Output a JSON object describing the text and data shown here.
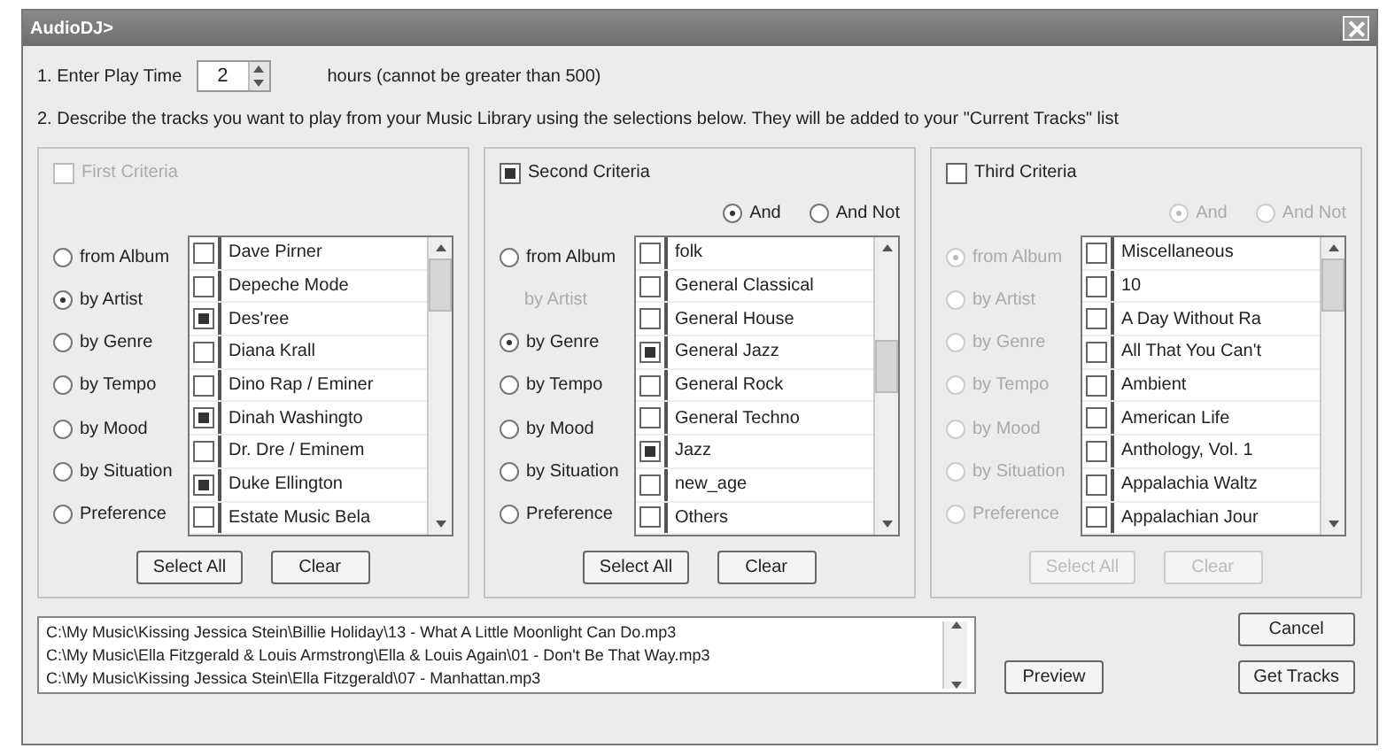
{
  "window": {
    "title": "AudioDJ>"
  },
  "play_time": {
    "label": "1. Enter Play Time",
    "value": "2",
    "hint": "hours (cannot be greater than 500)"
  },
  "instructions": "2. Describe the tracks you want to play from your Music Library using the selections below.  They will be added to your \"Current Tracks\" list",
  "criteria": [
    {
      "label": "First Criteria",
      "checked": false,
      "disabled": true,
      "enabled": true,
      "options": [
        {
          "kind": "radio",
          "label": "from Album",
          "selected": false
        },
        {
          "kind": "radio",
          "label": "by Artist",
          "selected": true
        },
        {
          "kind": "radio",
          "label": "by Genre",
          "selected": false
        },
        {
          "kind": "radio",
          "label": "by Tempo",
          "selected": false
        },
        {
          "kind": "radio",
          "label": "by Mood",
          "selected": false
        },
        {
          "kind": "radio",
          "label": "by Situation",
          "selected": false
        },
        {
          "kind": "radio",
          "label": "Preference",
          "selected": false
        }
      ],
      "items": [
        {
          "label": "Dave Pirner",
          "checked": false
        },
        {
          "label": "Depeche Mode",
          "checked": false
        },
        {
          "label": "Des'ree",
          "checked": true
        },
        {
          "label": "Diana Krall",
          "checked": false
        },
        {
          "label": "Dino Rap / Eminer",
          "checked": false
        },
        {
          "label": "Dinah Washingto",
          "checked": true
        },
        {
          "label": "Dr. Dre / Eminem",
          "checked": false
        },
        {
          "label": "Duke Ellington",
          "checked": true
        },
        {
          "label": "Estate Music Bela",
          "checked": false
        }
      ],
      "buttons": [
        "Select All",
        "Clear"
      ]
    },
    {
      "label": "Second Criteria",
      "checked": true,
      "disabled": false,
      "enabled": true,
      "joins": [
        {
          "label": "And",
          "selected": true
        },
        {
          "label": "And Not",
          "selected": false
        }
      ],
      "options": [
        {
          "kind": "radio",
          "label": "from Album",
          "selected": false
        },
        {
          "kind": "note",
          "label": "by Artist"
        },
        {
          "kind": "radio",
          "label": "by Genre",
          "selected": true
        },
        {
          "kind": "radio",
          "label": "by Tempo",
          "selected": false
        },
        {
          "kind": "radio",
          "label": "by Mood",
          "selected": false
        },
        {
          "kind": "radio",
          "label": "by Situation",
          "selected": false
        },
        {
          "kind": "radio",
          "label": "Preference",
          "selected": false
        }
      ],
      "items": [
        {
          "label": "folk",
          "checked": false
        },
        {
          "label": "General Classical",
          "checked": false
        },
        {
          "label": "General House",
          "checked": false
        },
        {
          "label": "General Jazz",
          "checked": true
        },
        {
          "label": "General Rock",
          "checked": false
        },
        {
          "label": "General Techno",
          "checked": false
        },
        {
          "label": "Jazz",
          "checked": true
        },
        {
          "label": "new_age",
          "checked": false
        },
        {
          "label": "Others",
          "checked": false
        }
      ],
      "buttons": [
        "Select All",
        "Clear"
      ]
    },
    {
      "label": "Third Criteria",
      "checked": false,
      "disabled": false,
      "enabled": false,
      "joins": [
        {
          "label": "And",
          "selected": true
        },
        {
          "label": "And Not",
          "selected": false
        }
      ],
      "options": [
        {
          "kind": "radio",
          "label": "from Album",
          "selected": true
        },
        {
          "kind": "radio",
          "label": "by Artist",
          "selected": false
        },
        {
          "kind": "radio",
          "label": "by Genre",
          "selected": false
        },
        {
          "kind": "radio",
          "label": "by Tempo",
          "selected": false
        },
        {
          "kind": "radio",
          "label": "by Mood",
          "selected": false
        },
        {
          "kind": "radio",
          "label": "by Situation",
          "selected": false
        },
        {
          "kind": "radio",
          "label": "Preference",
          "selected": false
        }
      ],
      "items": [
        {
          "label": "Miscellaneous",
          "checked": false
        },
        {
          "label": "10",
          "checked": false
        },
        {
          "label": "A Day Without Ra",
          "checked": false
        },
        {
          "label": "All That You Can't",
          "checked": false
        },
        {
          "label": "Ambient",
          "checked": false
        },
        {
          "label": "American Life",
          "checked": false
        },
        {
          "label": "Anthology, Vol. 1",
          "checked": false
        },
        {
          "label": "Appalachia Waltz",
          "checked": false
        },
        {
          "label": "Appalachian Jour",
          "checked": false
        }
      ],
      "buttons": [
        "Select All",
        "Clear"
      ]
    }
  ],
  "tracks": [
    "C:\\My Music\\Kissing Jessica Stein\\Billie Holiday\\13 - What A Little Moonlight Can Do.mp3",
    "C:\\My Music\\Ella Fitzgerald & Louis Armstrong\\Ella & Louis Again\\01 - Don't Be That Way.mp3",
    "C:\\My Music\\Kissing Jessica Stein\\Ella Fitzgerald\\07 - Manhattan.mp3"
  ],
  "buttons": {
    "cancel": "Cancel",
    "preview": "Preview",
    "get_tracks": "Get Tracks"
  }
}
